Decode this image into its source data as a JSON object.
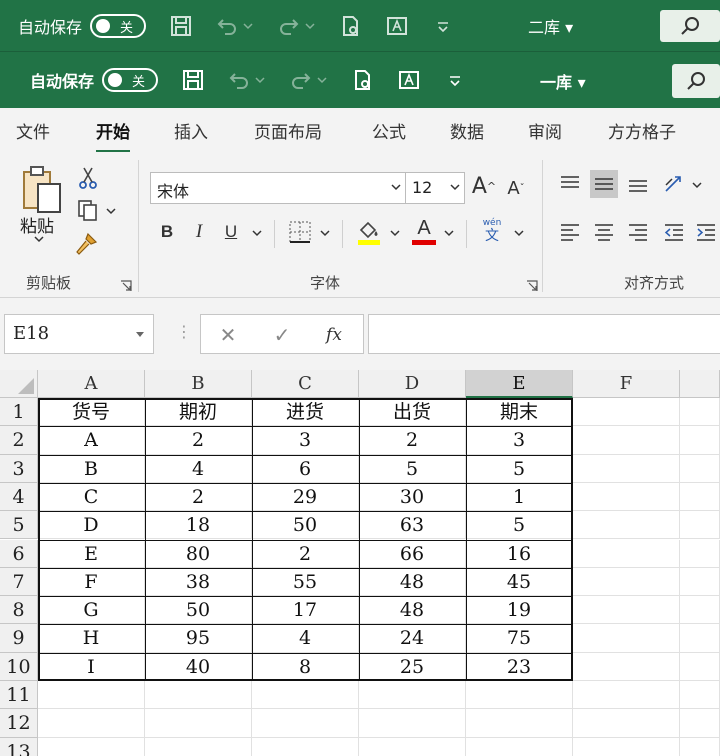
{
  "titlebar_back": {
    "autosave_label": "自动保存",
    "toggle_state": "关",
    "doc_name": "二库 ▾"
  },
  "titlebar": {
    "autosave_label": "自动保存",
    "toggle_state": "关",
    "doc_name": "一库 ▾"
  },
  "ribbon": {
    "tabs": [
      "文件",
      "开始",
      "插入",
      "页面布局",
      "公式",
      "数据",
      "审阅",
      "方方格子"
    ],
    "active_tab": "开始",
    "clipboard": {
      "paste_label": "粘贴",
      "group_label": "剪贴板"
    },
    "font": {
      "font_name": "宋体",
      "font_size": "12",
      "grow_label": "A",
      "shrink_label": "A",
      "bold_label": "B",
      "italic_label": "I",
      "underline_label": "U",
      "font_color_label": "A",
      "phonetic_top": "wén",
      "phonetic_bottom": "文",
      "group_label": "字体"
    },
    "alignment": {
      "group_label": "对齐方式"
    }
  },
  "formula_bar": {
    "name_box": "E18",
    "fx_label": "fx",
    "formula": ""
  },
  "sheet": {
    "columns": [
      "A",
      "B",
      "C",
      "D",
      "E",
      "F"
    ],
    "selected_column": "E",
    "rows": [
      "1",
      "2",
      "3",
      "4",
      "5",
      "6",
      "7",
      "8",
      "9",
      "10",
      "11",
      "12",
      "13"
    ],
    "cells": [
      [
        "货号",
        "期初",
        "进货",
        "出货",
        "期末"
      ],
      [
        "A",
        "2",
        "3",
        "2",
        "3"
      ],
      [
        "B",
        "4",
        "6",
        "5",
        "5"
      ],
      [
        "C",
        "2",
        "29",
        "30",
        "1"
      ],
      [
        "D",
        "18",
        "50",
        "63",
        "5"
      ],
      [
        "E",
        "80",
        "2",
        "66",
        "16"
      ],
      [
        "F",
        "38",
        "55",
        "48",
        "45"
      ],
      [
        "G",
        "50",
        "17",
        "48",
        "19"
      ],
      [
        "H",
        "95",
        "4",
        "24",
        "75"
      ],
      [
        "I",
        "40",
        "8",
        "25",
        "23"
      ]
    ]
  },
  "colors": {
    "excel_green": "#217346",
    "font_highlight": "#ffff00",
    "font_color": "#e00000"
  }
}
